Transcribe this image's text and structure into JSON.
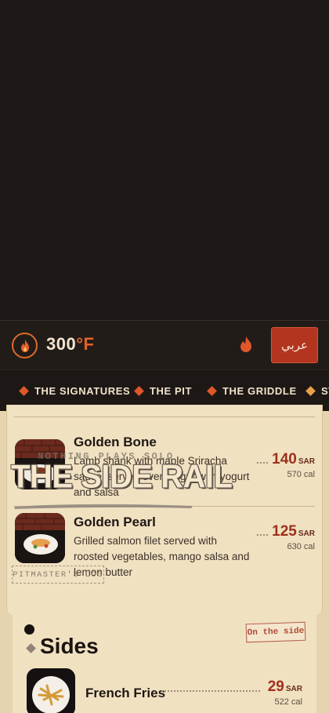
{
  "header": {
    "temperature_value": "300",
    "temperature_unit": "°F",
    "language_button": "عربي",
    "logo_icon": "flame-icon",
    "action_icon": "flame-icon"
  },
  "nav": {
    "items": [
      {
        "label": "THE SIGNATURES"
      },
      {
        "label": "THE PIT"
      },
      {
        "label": "THE GRIDDLE"
      },
      {
        "label": "ST"
      }
    ]
  },
  "section": {
    "title": "THE SIDE RAIL",
    "tagline": "NOTHING PLAYS SOLO",
    "stamp": "PITMASTER'S LOG"
  },
  "dishes": [
    {
      "name": "Golden Bone",
      "description": "Lamb shank with maple Sriracha sauce, served over bulgur with yogurt and salsa",
      "price": "140",
      "currency": "SAR",
      "calories": "570 cal"
    },
    {
      "name": "Golden Pearl",
      "description": "Grilled salmon filet served with roosted vegetables, mango salsa and lemon butter",
      "price": "125",
      "currency": "SAR",
      "calories": "630 cal"
    }
  ],
  "sides": {
    "title": "Sides",
    "badge": "On the side",
    "items": [
      {
        "name": "French Fries",
        "price": "29",
        "currency": "SAR",
        "calories": "522 cal"
      }
    ]
  },
  "colors": {
    "accent": "#e0572a",
    "price": "#9f2f1b",
    "background_dark": "#1d1815",
    "paper": "#f0e1c1"
  }
}
